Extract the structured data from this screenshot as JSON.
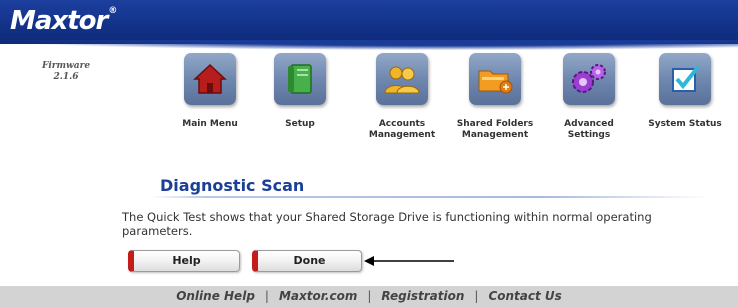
{
  "header": {
    "logo_text": "Maxtor",
    "logo_mark": "®"
  },
  "firmware": {
    "label": "Firmware",
    "version": "2.1.6"
  },
  "nav": [
    {
      "label": "Main Menu",
      "icon": "house-icon"
    },
    {
      "label": "Setup",
      "icon": "book-icon"
    },
    {
      "label": "Accounts Management",
      "icon": "users-icon"
    },
    {
      "label": "Shared Folders Management",
      "icon": "shared-folder-icon"
    },
    {
      "label": "Advanced Settings",
      "icon": "gears-icon"
    },
    {
      "label": "System Status",
      "icon": "checkbox-icon"
    }
  ],
  "diagnostic": {
    "title": "Diagnostic Scan",
    "message": "The Quick Test shows that your Shared Storage Drive is functioning within normal operating parameters."
  },
  "buttons": {
    "help": "Help",
    "done": "Done"
  },
  "footer": {
    "links": [
      "Online Help",
      "Maxtor.com",
      "Registration",
      "Contact Us"
    ],
    "separator": "|"
  },
  "colors": {
    "banner": "#13338a",
    "title": "#1b3e96",
    "button_accent": "#c41b1b",
    "footer": "#d3d3d3"
  }
}
